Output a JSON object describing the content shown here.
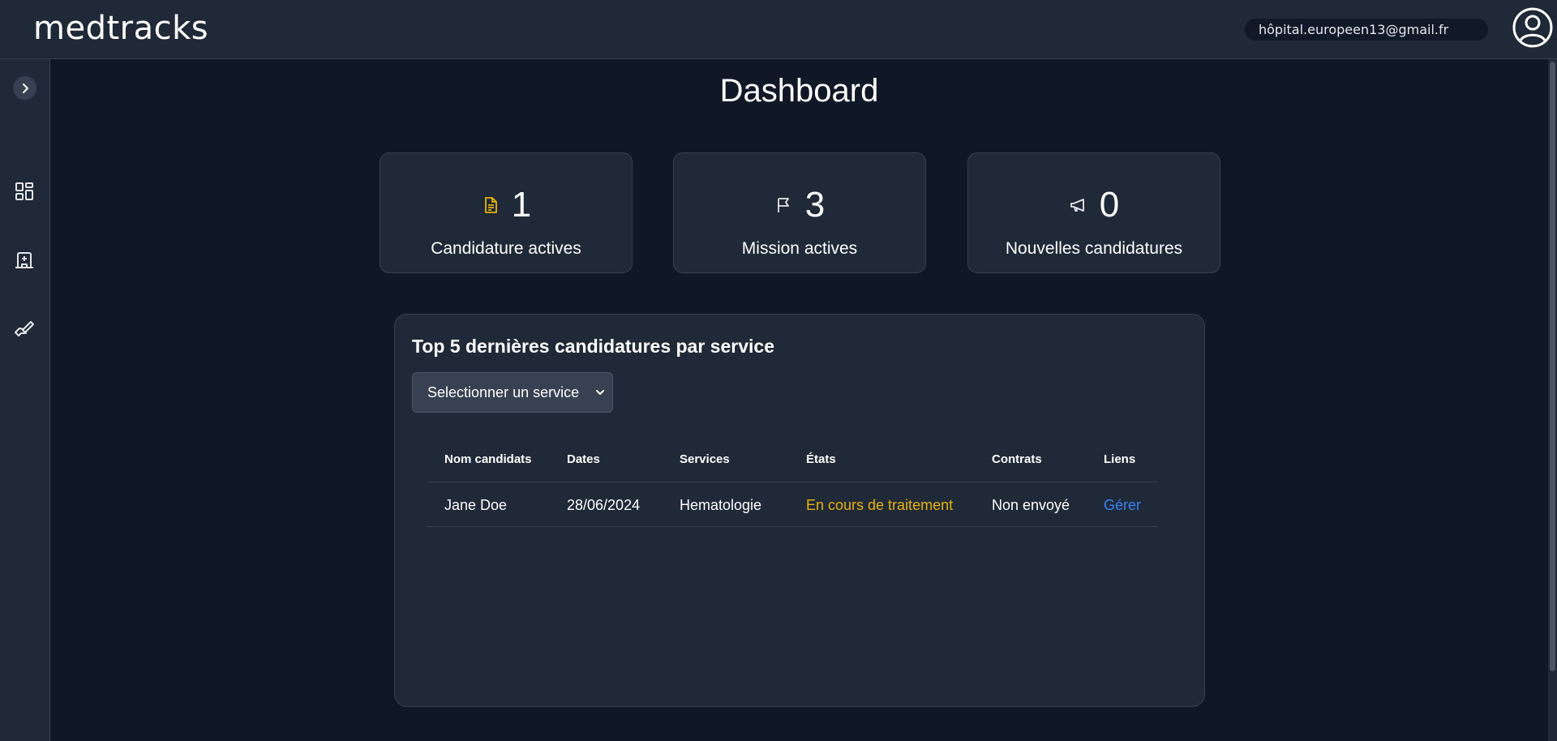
{
  "header": {
    "logo": "medtracks",
    "email": "hôpital.europeen13@gmail.fr"
  },
  "icons": {
    "sidebar": [
      "chevron-right-icon",
      "dashboard-grid-icon",
      "hospital-building-icon",
      "handshake-icon"
    ],
    "stats": [
      "document-icon",
      "flag-icon",
      "megaphone-icon"
    ],
    "profile": "user-circle-icon"
  },
  "colors": {
    "background": "#101828",
    "surface": "#1f2937",
    "border": "#374151",
    "document_icon": "#eab308",
    "state_text": "#eab308",
    "link_text": "#3b82f6"
  },
  "main": {
    "title": "Dashboard",
    "stats": [
      {
        "value": "1",
        "label": "Candidature actives"
      },
      {
        "value": "3",
        "label": "Mission actives"
      },
      {
        "value": "0",
        "label": "Nouvelles candidatures"
      }
    ],
    "panel": {
      "title": "Top 5 dernières candidatures par service",
      "select_value": "Selectionner un service",
      "columns": [
        "Nom candidats",
        "Dates",
        "Services",
        "États",
        "Contrats",
        "Liens"
      ],
      "rows": [
        {
          "name": "Jane Doe",
          "date": "28/06/2024",
          "service": "Hematologie",
          "state": "En cours de traitement",
          "contract": "Non envoyé",
          "link": "Gérer"
        }
      ]
    }
  }
}
